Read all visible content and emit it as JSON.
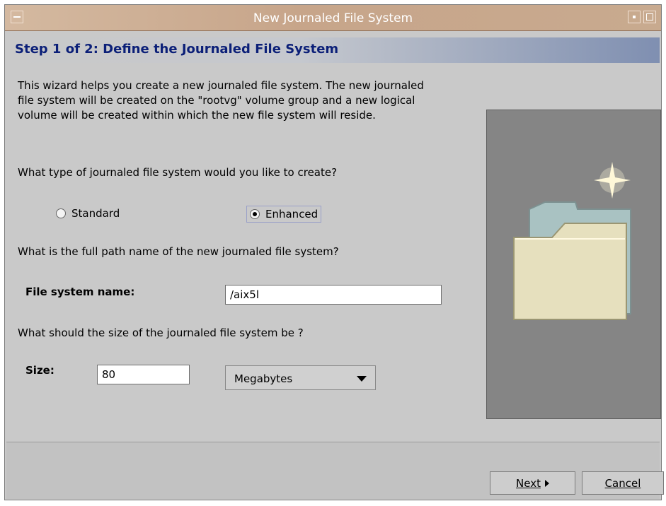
{
  "window": {
    "title": "New Journaled File System"
  },
  "header": {
    "step_title": "Step 1 of 2: Define the Journaled File System"
  },
  "content": {
    "intro": "This wizard helps you create a new journaled file system. The new journaled file system will be created on the \"rootvg\" volume group and a new logical volume will be created within which the new file system will reside.",
    "type_question": "What type of journaled file system would you like to create?",
    "radio_standard": "Standard",
    "radio_enhanced": "Enhanced",
    "selected_type": "Enhanced",
    "path_question": "What is the full path name of the new journaled file system?",
    "fs_name_label": "File system name:",
    "fs_name_value": "/aix5l",
    "size_question": "What should the size of the journaled file system be ?",
    "size_label": "Size:",
    "size_value": "80",
    "unit_selected": "Megabytes"
  },
  "buttons": {
    "next": "Next",
    "cancel": "Cancel"
  },
  "icons": {
    "window_menu": "window-menu-icon",
    "minimize": "minimize-icon",
    "maximize": "maximize-icon",
    "illustration": "folder-with-sparkle-icon",
    "dropdown_arrow": "chevron-down-icon",
    "next_arrow": "triangle-right-icon"
  },
  "colors": {
    "titlebar": "#c7a58a",
    "step_title": "#0b1f78",
    "background": "#c9c9c9",
    "illustration_panel": "#858585",
    "folder": "#e6e0be",
    "folder_back": "#a9c2c2"
  }
}
